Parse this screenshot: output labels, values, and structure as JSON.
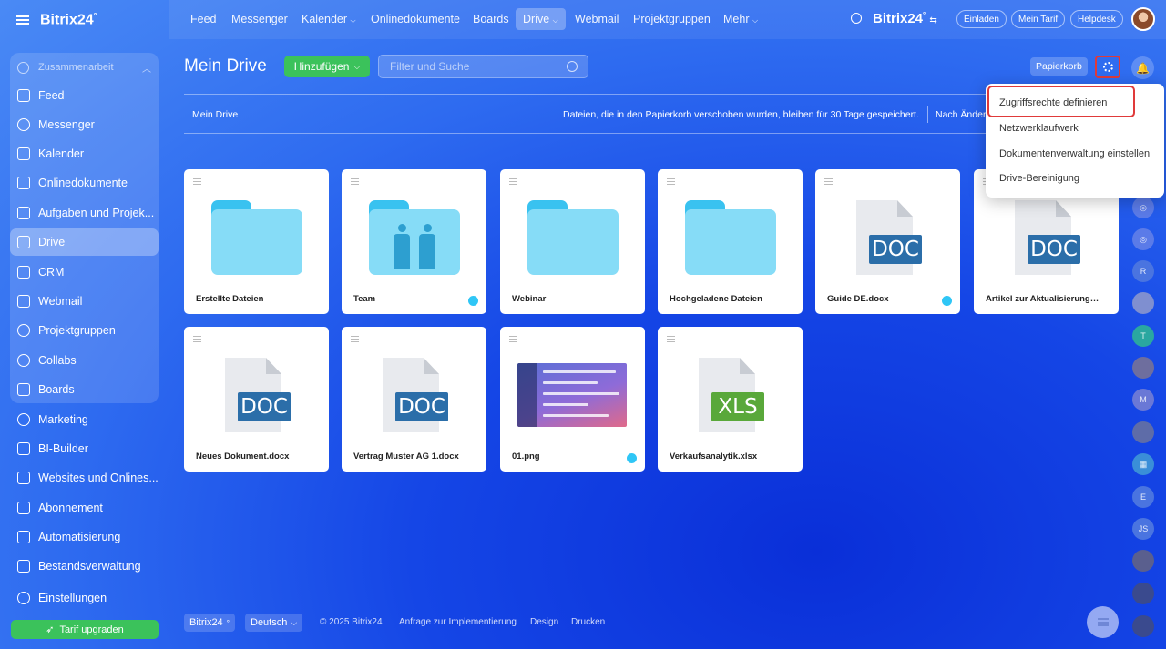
{
  "brand": {
    "name": "Bitrix24",
    "mark": "°"
  },
  "sidebar": {
    "group_label": "Zusammenarbeit",
    "items": [
      {
        "label": "Feed"
      },
      {
        "label": "Messenger"
      },
      {
        "label": "Kalender"
      },
      {
        "label": "Onlinedokumente"
      },
      {
        "label": "Aufgaben und Projek..."
      },
      {
        "label": "Drive"
      },
      {
        "label": "CRM"
      },
      {
        "label": "Webmail"
      },
      {
        "label": "Projektgruppen"
      },
      {
        "label": "Collabs"
      },
      {
        "label": "Boards"
      },
      {
        "label": "Marketing"
      },
      {
        "label": "BI-Builder"
      },
      {
        "label": "Websites und Onlines..."
      },
      {
        "label": "Abonnement"
      },
      {
        "label": "Automatisierung"
      },
      {
        "label": "Bestandsverwaltung"
      },
      {
        "label": "Einstellungen"
      }
    ],
    "upgrade_label": "Tarif upgraden"
  },
  "topnav": {
    "items": [
      "Feed",
      "Messenger",
      "Kalender",
      "Onlinedokumente",
      "Boards",
      "Drive",
      "Webmail",
      "Projektgruppen",
      "Mehr"
    ],
    "brand": "Bitrix24",
    "invite": "Einladen",
    "tariff": "Mein Tarif",
    "help": "Helpdesk"
  },
  "main": {
    "title": "Mein Drive",
    "add_label": "Hinzufügen",
    "search_placeholder": "Filter und Suche",
    "trash_label": "Papierkorb",
    "breadcrumb": "Mein Drive",
    "info": "Dateien, die in den Papierkorb verschoben wurden, bleiben für 30 Tage gespeichert.",
    "sort": "Nach Änder"
  },
  "files": [
    {
      "name": "Erstellte Dateien",
      "type": "folder",
      "shared": false
    },
    {
      "name": "Team",
      "type": "folder-team",
      "shared": true
    },
    {
      "name": "Webinar",
      "type": "folder",
      "shared": false
    },
    {
      "name": "Hochgeladene Dateien",
      "type": "folder",
      "shared": false
    },
    {
      "name": "Guide DE.docx",
      "type": "doc",
      "badge": "DOC",
      "shared": true
    },
    {
      "name": "Artikel zur Aktualisierung (M...",
      "type": "doc",
      "badge": "DOC",
      "shared": false
    },
    {
      "name": "Neues Dokument.docx",
      "type": "doc",
      "badge": "DOC",
      "shared": false
    },
    {
      "name": "Vertrag Muster AG 1.docx",
      "type": "doc",
      "badge": "DOC",
      "shared": false
    },
    {
      "name": "01.png",
      "type": "image",
      "shared": true
    },
    {
      "name": "Verkaufsanalytik.xlsx",
      "type": "xls",
      "badge": "XLS",
      "shared": false
    }
  ],
  "menu": {
    "items": [
      "Zugriffsrechte definieren",
      "Netzwerklaufwerk",
      "Dokumentenverwaltung einstellen",
      "Drive-Bereinigung"
    ]
  },
  "rail": [
    "R",
    "T",
    "M",
    "E",
    "JS"
  ],
  "footer": {
    "brand": "Bitrix24",
    "language": "Deutsch",
    "copyright": "© 2025 Bitrix24",
    "links": [
      "Anfrage zur Implementierung",
      "Design",
      "Drucken"
    ]
  },
  "colors": {
    "accent_green": "#3bc25b",
    "highlight_red": "#e03a3a",
    "doc_blue": "#2b6ea9",
    "xls_green": "#59a83a",
    "folder": "#86dcf7"
  }
}
